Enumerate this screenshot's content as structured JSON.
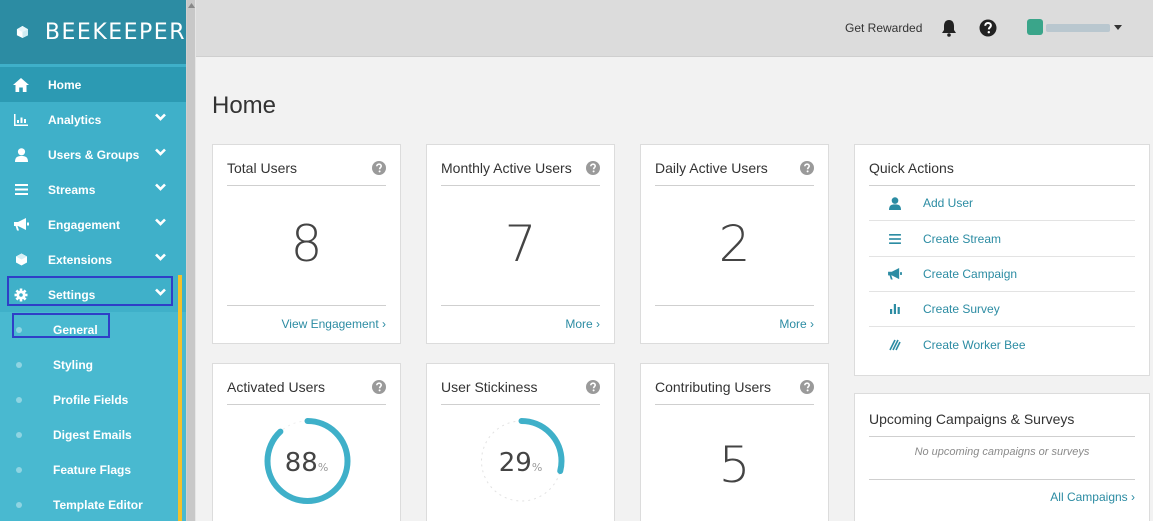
{
  "app": {
    "name": "BEEKEEPER"
  },
  "colors": {
    "brand": "#3fb0c9",
    "brand_dark": "#2c8ca3",
    "accent": "#f3c12b",
    "highlight": "#2f3fc7"
  },
  "sidebar": {
    "items": [
      {
        "label": "Home",
        "icon": "home-icon"
      },
      {
        "label": "Analytics",
        "icon": "chart-icon"
      },
      {
        "label": "Users & Groups",
        "icon": "user-icon"
      },
      {
        "label": "Streams",
        "icon": "menu-icon"
      },
      {
        "label": "Engagement",
        "icon": "megaphone-icon"
      },
      {
        "label": "Extensions",
        "icon": "puzzle-icon"
      },
      {
        "label": "Settings",
        "icon": "gear-icon"
      }
    ],
    "settings_sub": [
      {
        "label": "General"
      },
      {
        "label": "Styling"
      },
      {
        "label": "Profile Fields"
      },
      {
        "label": "Digest Emails"
      },
      {
        "label": "Feature Flags"
      },
      {
        "label": "Template Editor"
      }
    ]
  },
  "topbar": {
    "rewards": "Get Rewarded"
  },
  "page": {
    "title": "Home"
  },
  "cards": {
    "total_users": {
      "title": "Total Users",
      "value": "8",
      "link": "View Engagement ›"
    },
    "monthly_active": {
      "title": "Monthly Active Users",
      "value": "7",
      "link": "More ›"
    },
    "daily_active": {
      "title": "Daily Active Users",
      "value": "2",
      "link": "More ›"
    },
    "activated": {
      "title": "Activated Users",
      "value": "88",
      "unit": "%",
      "percent": 88
    },
    "stickiness": {
      "title": "User Stickiness",
      "value": "29",
      "unit": "%",
      "percent": 29
    },
    "contributing": {
      "title": "Contributing Users",
      "value": "5"
    }
  },
  "quick_actions": {
    "title": "Quick Actions",
    "items": [
      {
        "label": "Add User",
        "icon": "user-icon"
      },
      {
        "label": "Create Stream",
        "icon": "menu-icon"
      },
      {
        "label": "Create Campaign",
        "icon": "megaphone-icon"
      },
      {
        "label": "Create Survey",
        "icon": "bar-chart-icon"
      },
      {
        "label": "Create Worker Bee",
        "icon": "worker-bee-icon"
      }
    ]
  },
  "upcoming": {
    "title": "Upcoming Campaigns & Surveys",
    "empty": "No upcoming campaigns or surveys",
    "link": "All Campaigns ›"
  }
}
